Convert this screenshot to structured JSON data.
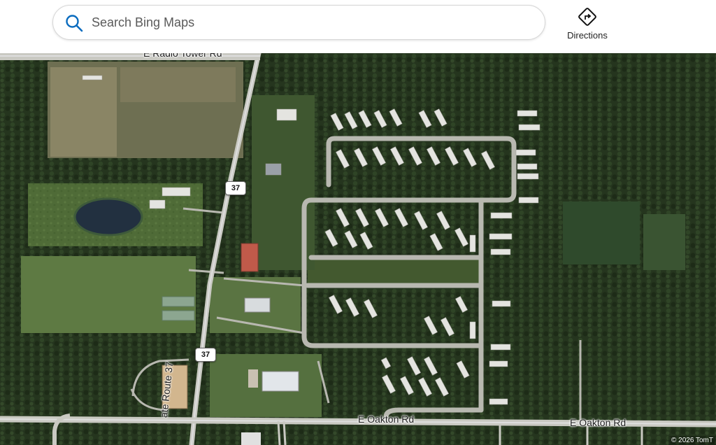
{
  "search": {
    "placeholder": "Search Bing Maps",
    "value": ""
  },
  "toolbar": {
    "directions_label": "Directions"
  },
  "map": {
    "roads": {
      "radio_tower": "E Radio Tower Rd",
      "oakton_left": "E Oakton Rd",
      "oakton_right": "E Oakton Rd",
      "state_route": "ate Route 37"
    },
    "shields": {
      "upper": "37",
      "lower": "37"
    },
    "copyright": "© 2026 TomT"
  },
  "colors": {
    "accent": "#0078d4",
    "forest": "#23321c",
    "field": "#4f6a36",
    "road": "#c9c9c2"
  }
}
